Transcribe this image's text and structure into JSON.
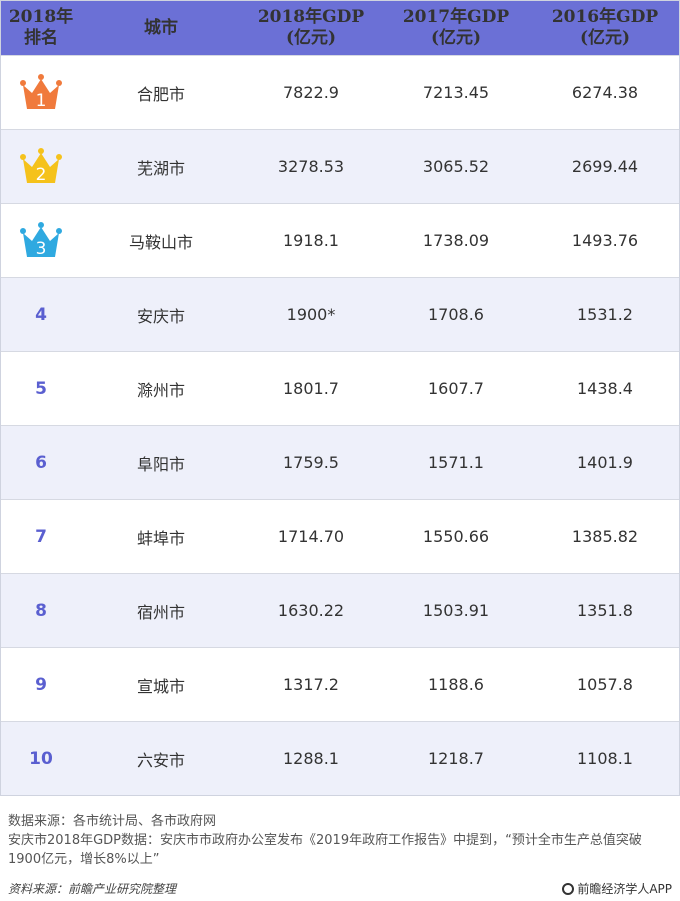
{
  "header": {
    "rank": "2018年\n排名",
    "city": "城市",
    "gdp2018": "2018年GDP\n(亿元)",
    "gdp2017": "2017年GDP\n(亿元)",
    "gdp2016": "2016年GDP\n(亿元)"
  },
  "rows": [
    {
      "rank": "1",
      "city": "合肥市",
      "g2018": "7822.9",
      "g2017": "7213.45",
      "g2016": "6274.38",
      "crown_color": "#f07a3c"
    },
    {
      "rank": "2",
      "city": "芜湖市",
      "g2018": "3278.53",
      "g2017": "3065.52",
      "g2016": "2699.44",
      "crown_color": "#f5c21b"
    },
    {
      "rank": "3",
      "city": "马鞍山市",
      "g2018": "1918.1",
      "g2017": "1738.09",
      "g2016": "1493.76",
      "crown_color": "#2fa9e0"
    },
    {
      "rank": "4",
      "city": "安庆市",
      "g2018": "1900*",
      "g2017": "1708.6",
      "g2016": "1531.2"
    },
    {
      "rank": "5",
      "city": "滁州市",
      "g2018": "1801.7",
      "g2017": "1607.7",
      "g2016": "1438.4"
    },
    {
      "rank": "6",
      "city": "阜阳市",
      "g2018": "1759.5",
      "g2017": "1571.1",
      "g2016": "1401.9"
    },
    {
      "rank": "7",
      "city": "蚌埠市",
      "g2018": "1714.70",
      "g2017": "1550.66",
      "g2016": "1385.82"
    },
    {
      "rank": "8",
      "city": "宿州市",
      "g2018": "1630.22",
      "g2017": "1503.91",
      "g2016": "1351.8"
    },
    {
      "rank": "9",
      "city": "宣城市",
      "g2018": "1317.2",
      "g2017": "1188.6",
      "g2016": "1057.8"
    },
    {
      "rank": "10",
      "city": "六安市",
      "g2018": "1288.1",
      "g2017": "1218.7",
      "g2016": "1108.1"
    }
  ],
  "footer": {
    "source": "数据来源：各市统计局、各市政府网",
    "note": "安庆市2018年GDP数据：安庆市市政府办公室发布《2019年政府工作报告》中提到，“预计全市生产总值突破1900亿元，增长8%以上”",
    "compiled_by": "资料来源：前瞻产业研究院整理",
    "brand": "前瞻经济学人APP"
  },
  "colors": {
    "header_bg": "#6b70d6",
    "rank_text": "#5a5fd0",
    "alt_row_bg": "#eef0fa"
  }
}
